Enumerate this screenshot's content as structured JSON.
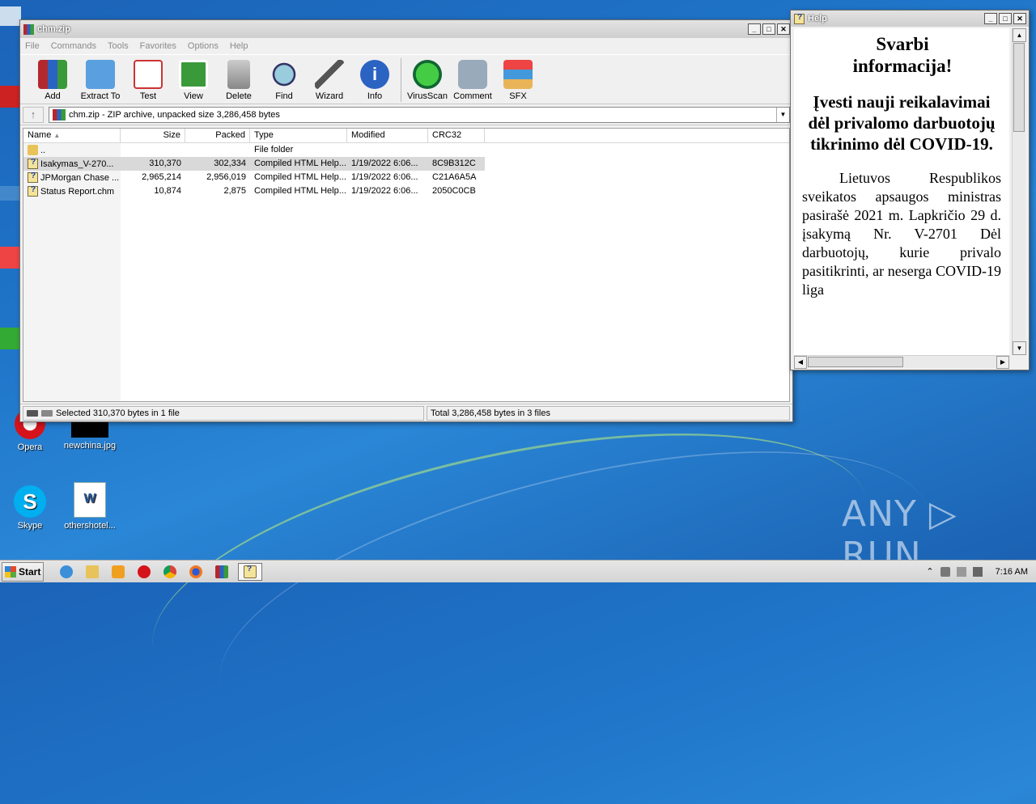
{
  "desktop": {
    "icons": [
      {
        "label": "Opera"
      },
      {
        "label": "newchina.jpg"
      },
      {
        "label": "Skype"
      },
      {
        "label": "othershotel..."
      }
    ],
    "watermark": "ANY ▷ RUN"
  },
  "winrar": {
    "title": "chm.zip",
    "menu": [
      "File",
      "Commands",
      "Tools",
      "Favorites",
      "Options",
      "Help"
    ],
    "toolbar": [
      "Add",
      "Extract To",
      "Test",
      "View",
      "Delete",
      "Find",
      "Wizard",
      "Info",
      "VirusScan",
      "Comment",
      "SFX"
    ],
    "address": "chm.zip - ZIP archive, unpacked size 3,286,458 bytes",
    "columns": [
      "Name",
      "Size",
      "Packed",
      "Type",
      "Modified",
      "CRC32"
    ],
    "rows": [
      {
        "name": "..",
        "size": "",
        "packed": "",
        "type": "File folder",
        "modified": "",
        "crc": "",
        "icon": "folder-icon"
      },
      {
        "name": "Isakymas_V-270...",
        "size": "310,370",
        "packed": "302,334",
        "type": "Compiled HTML Help...",
        "modified": "1/19/2022 6:06...",
        "crc": "8C9B312C",
        "icon": "chm-file-icon",
        "selected": true
      },
      {
        "name": "JPMorgan Chase ...",
        "size": "2,965,214",
        "packed": "2,956,019",
        "type": "Compiled HTML Help...",
        "modified": "1/19/2022 6:06...",
        "crc": "C21A6A5A",
        "icon": "chm-file-icon"
      },
      {
        "name": "Status Report.chm",
        "size": "10,874",
        "packed": "2,875",
        "type": "Compiled HTML Help...",
        "modified": "1/19/2022 6:06...",
        "crc": "2050C0CB",
        "icon": "chm-file-icon"
      }
    ],
    "status_left": "Selected 310,370 bytes in 1 file",
    "status_right": "Total 3,286,458 bytes in 3 files"
  },
  "help": {
    "title": "Help",
    "heading1": "Svarbi informacija!",
    "heading2": "Įvesti nauji reikalavimai dėl privalomo darbuotojų tikrinimo dėl COVID-19.",
    "paragraph": "Lietuvos Respublikos sveikatos apsaugos ministras pasirašė 2021 m. Lapkričio 29 d. įsakymą Nr. V-2701 Dėl darbuotojų, kurie privalo pasitikrinti, ar neserga COVID-19 liga"
  },
  "taskbar": {
    "start": "Start",
    "clock": "7:16 AM"
  }
}
